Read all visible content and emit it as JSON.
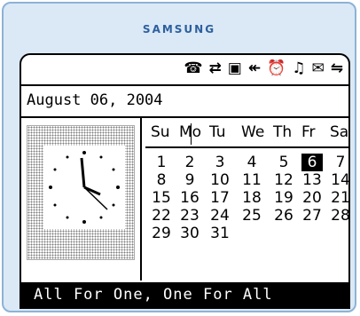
{
  "brand": "SAMSUNG",
  "status_icons": [
    "phone-icon",
    "sync-icon",
    "screen-icon",
    "call-back-icon",
    "alarm-off-icon",
    "bell-icon",
    "mail-icon",
    "network-icon"
  ],
  "status_glyphs": [
    "☎",
    "⇄",
    "▣",
    "↞",
    "⏰",
    "♫",
    "✉",
    "⇋"
  ],
  "date": "August 06, 2004",
  "weekdays": [
    "Su",
    "Mo",
    "Tu",
    "We",
    "Th",
    "Fr",
    "Sa"
  ],
  "weeks": [
    [
      "",
      "",
      "",
      "",
      "",
      "",
      ""
    ],
    [
      "1",
      "2",
      "3",
      "4",
      "5",
      "6",
      "7"
    ],
    [
      "8",
      "9",
      "10",
      "11",
      "12",
      "13",
      "14"
    ],
    [
      "15",
      "16",
      "17",
      "18",
      "19",
      "20",
      "21"
    ],
    [
      "22",
      "23",
      "24",
      "25",
      "26",
      "27",
      "28"
    ],
    [
      "29",
      "30",
      "31",
      "",
      "",
      "",
      ""
    ]
  ],
  "today": "6",
  "footer_text": "All For One, One For All",
  "colors": {
    "frame": "#dbe9f6",
    "brand": "#2d5f9e",
    "screen": "#ffffff",
    "footer_bg": "#000000"
  }
}
